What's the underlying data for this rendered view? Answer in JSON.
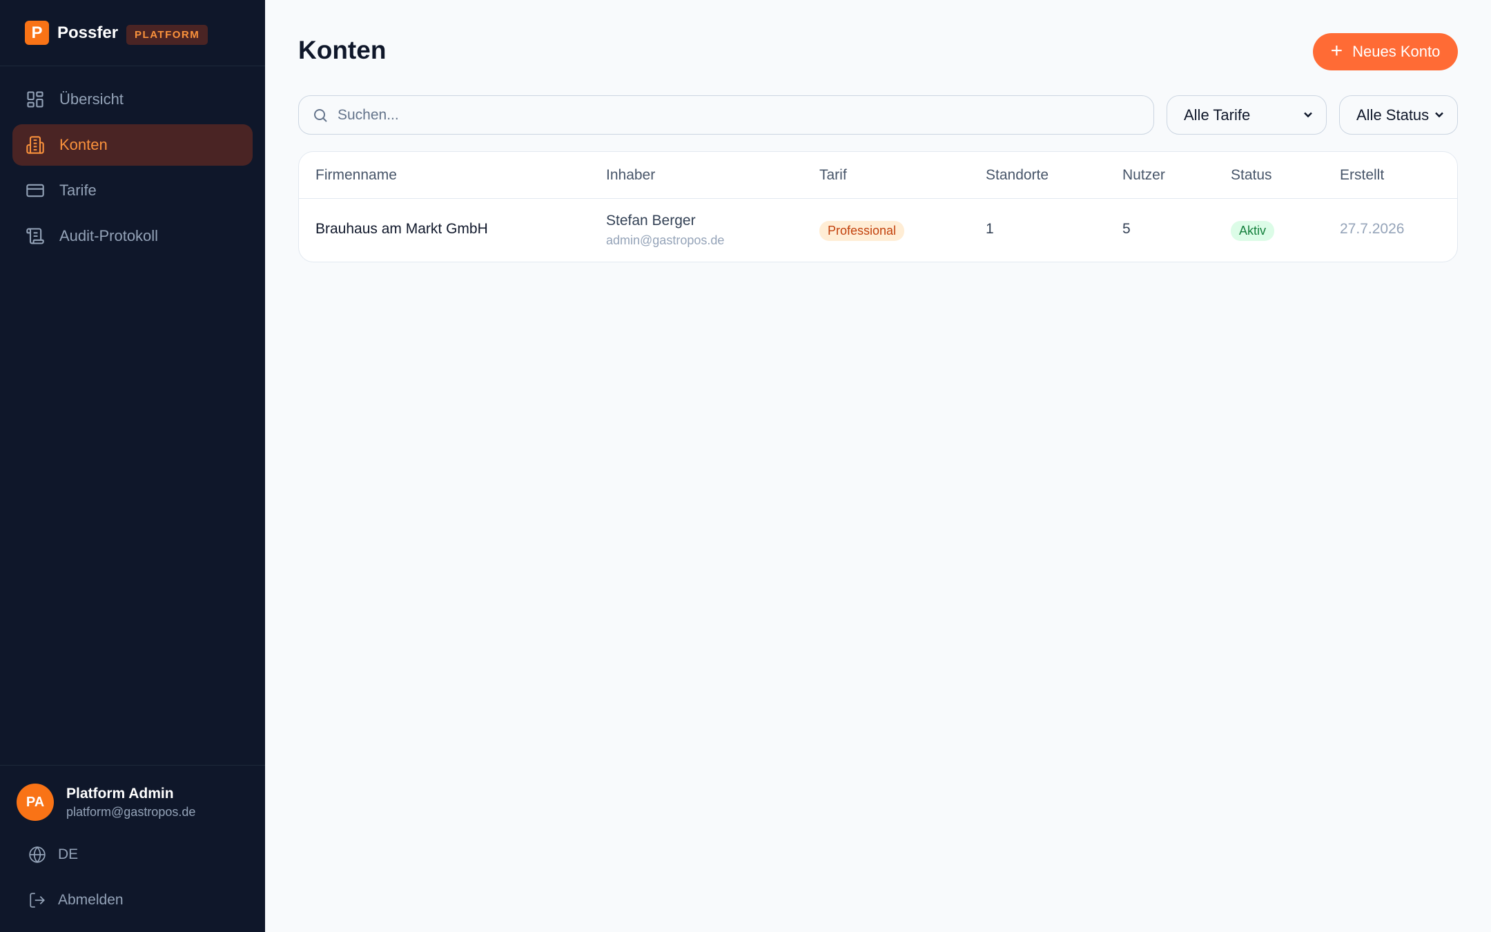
{
  "brand": {
    "logo_letter": "P",
    "name": "Possfer",
    "badge": "PLATFORM"
  },
  "sidebar": {
    "items": [
      {
        "label": "Übersicht",
        "icon": "dashboard-icon",
        "active": false
      },
      {
        "label": "Konten",
        "icon": "building-icon",
        "active": true
      },
      {
        "label": "Tarife",
        "icon": "credit-card-icon",
        "active": false
      },
      {
        "label": "Audit-Protokoll",
        "icon": "scroll-icon",
        "active": false
      }
    ],
    "user": {
      "initials": "PA",
      "name": "Platform Admin",
      "email": "platform@gastropos.de"
    },
    "language": "DE",
    "logout": "Abmelden"
  },
  "main": {
    "title": "Konten",
    "new_button": "Neues Konto",
    "search": {
      "placeholder": "Suchen..."
    },
    "filters": {
      "plan": "Alle Tarife",
      "status": "Alle Status"
    },
    "table": {
      "columns": [
        "Firmenname",
        "Inhaber",
        "Tarif",
        "Standorte",
        "Nutzer",
        "Status",
        "Erstellt"
      ],
      "rows": [
        {
          "company": "Brauhaus am Markt GmbH",
          "owner_name": "Stefan Berger",
          "owner_email": "admin@gastropos.de",
          "plan": "Professional",
          "locations": "1",
          "users": "5",
          "status": "Aktiv",
          "created": "27.7.2026"
        }
      ]
    }
  },
  "colors": {
    "accent": "#ff6b35",
    "sidebar_bg": "#0f172a",
    "status_active": "#15803d",
    "plan_badge": "#c2410c"
  }
}
